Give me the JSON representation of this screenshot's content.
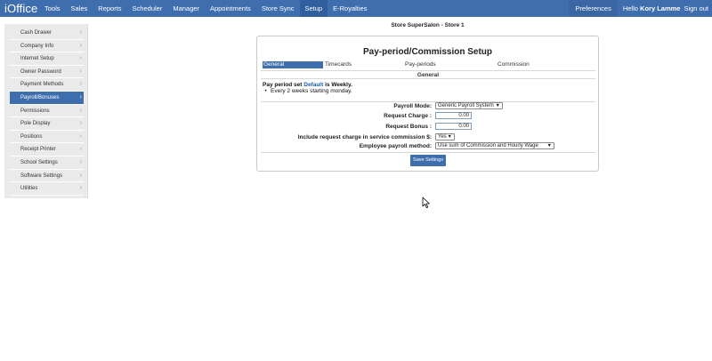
{
  "app": {
    "logo": "iOffice",
    "nav": [
      "Tools",
      "Sales",
      "Reports",
      "Scheduler",
      "Manager",
      "Appointments",
      "Store Sync",
      "Setup",
      "E-Royalties"
    ],
    "active_nav_index": 7,
    "preferences": "Preferences",
    "hello": "Hello",
    "user_name": "Kory Lamme",
    "sign_out": "Sign out"
  },
  "sidebar": {
    "items": [
      "Cash Drawer",
      "Company Info",
      "Internet Setup",
      "Owner Password",
      "Payment Methods",
      "Payroll/Bonuses",
      "Permissions",
      "Pole Display",
      "Positions",
      "Receipt Printer",
      "School Settings",
      "Software Settings",
      "Utilities"
    ],
    "active_index": 5
  },
  "main": {
    "store_title": "Store SuperSalon - Store 1",
    "panel_title": "Pay-period/Commission Setup",
    "tabs": [
      "General",
      "Timecards",
      "Pay-periods",
      "Commission"
    ],
    "active_tab_index": 0,
    "section_title": "General",
    "pay_period_prefix": "Pay period set",
    "pay_period_link": "Default",
    "pay_period_suffix": "is Weekly.",
    "pay_period_detail": "Every 2 weeks starting monday.",
    "form": {
      "payroll_mode_label": "Payroll Mode:",
      "payroll_mode_value": "Generic Payroll System",
      "request_charge_label": "Request Charge :",
      "request_charge_value": "0.00",
      "request_bonus_label": "Request Bonus :",
      "request_bonus_value": "0.00",
      "include_request_label": "Include request charge in service commission $:",
      "include_request_value": "Yes",
      "employee_payroll_label": "Employee payroll method:",
      "employee_payroll_value": "Use sum of Commission and Hourly Wage"
    },
    "save_button": "Save Settings"
  },
  "colors": {
    "nav_bg": "#3f6eaf",
    "accent": "#3f6eaf",
    "link": "#1a5fb4"
  }
}
